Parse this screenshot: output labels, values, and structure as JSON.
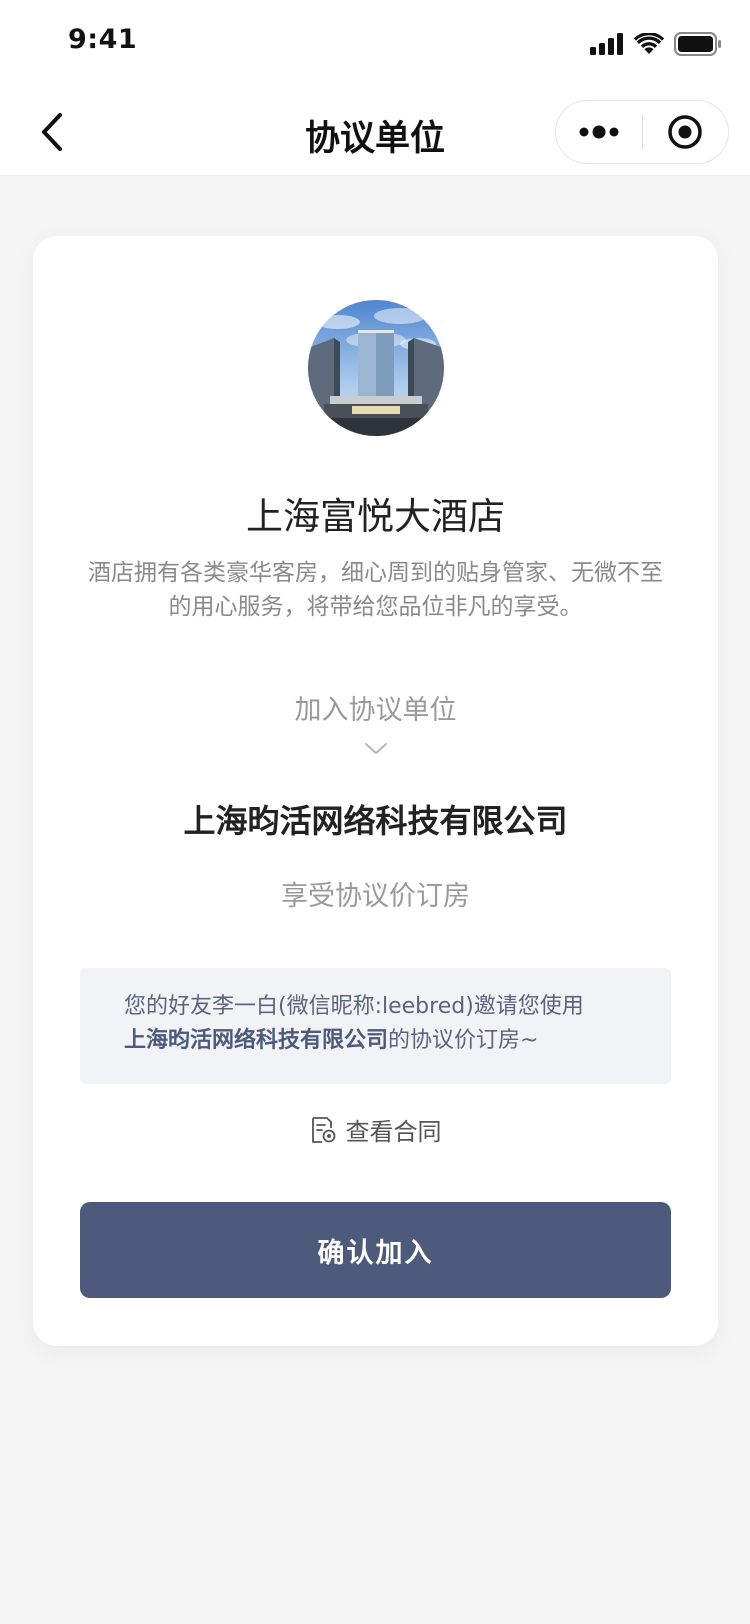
{
  "status_bar": {
    "time": "9:41",
    "icons": [
      "cellular-signal-icon",
      "wifi-icon",
      "battery-icon"
    ]
  },
  "nav": {
    "title": "协议单位",
    "back_icon": "chevron-left-icon",
    "more_icon": "more-dots-icon",
    "close_icon": "target-close-icon"
  },
  "hotel": {
    "name": "上海富悦大酒店",
    "description": "酒店拥有各类豪华客房，细心周到的贴身管家、无微不至的用心服务，将带给您品位非凡的享受。"
  },
  "join": {
    "label": "加入协议单位",
    "company": "上海昀活网络科技有限公司",
    "benefit": "享受协议价订房"
  },
  "invite": {
    "text_prefix": "您的好友李一白(微信昵称:leebred)邀请您使用",
    "company": "上海昀活网络科技有限公司",
    "text_suffix": "的协议价订房~"
  },
  "contract": {
    "label": "查看合同",
    "icon": "contract-document-icon"
  },
  "actions": {
    "confirm_label": "确认加入"
  },
  "colors": {
    "primary": "#4d5a7b",
    "background": "#f5f5f6",
    "card": "#ffffff",
    "invite_bg": "#f2f3f6"
  }
}
